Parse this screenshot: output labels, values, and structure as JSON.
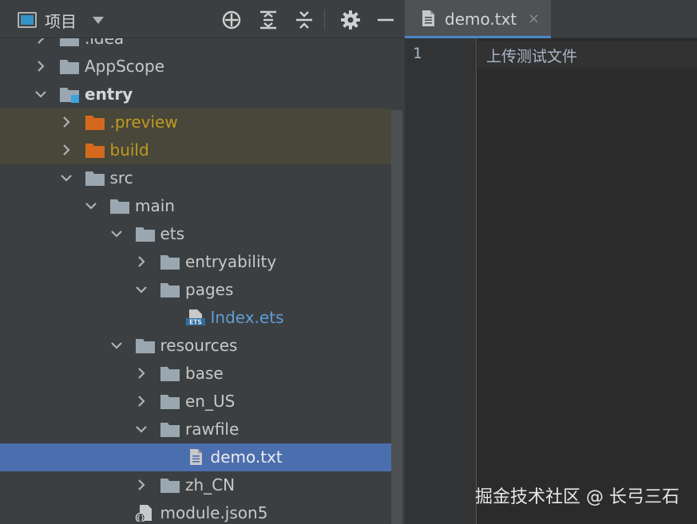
{
  "project_panel": {
    "title": "项目",
    "toolbar": [
      {
        "name": "locate-icon"
      },
      {
        "name": "expand-all-icon"
      },
      {
        "name": "collapse-all-icon"
      },
      {
        "name": "settings-gear-icon"
      },
      {
        "name": "hide-panel-icon"
      }
    ],
    "tree": [
      {
        "label": ".idea",
        "depth": 1,
        "type": "folder",
        "expanded": false,
        "style": "normal",
        "partial": true
      },
      {
        "label": "AppScope",
        "depth": 1,
        "type": "folder",
        "expanded": false,
        "style": "normal"
      },
      {
        "label": "entry",
        "depth": 1,
        "type": "module",
        "expanded": true,
        "style": "bold"
      },
      {
        "label": ".preview",
        "depth": 2,
        "type": "folder-excluded",
        "expanded": false,
        "style": "excluded"
      },
      {
        "label": "build",
        "depth": 2,
        "type": "folder-excluded",
        "expanded": false,
        "style": "excluded"
      },
      {
        "label": "src",
        "depth": 2,
        "type": "folder",
        "expanded": true,
        "style": "normal"
      },
      {
        "label": "main",
        "depth": 3,
        "type": "folder",
        "expanded": true,
        "style": "normal"
      },
      {
        "label": "ets",
        "depth": 4,
        "type": "folder",
        "expanded": true,
        "style": "normal"
      },
      {
        "label": "entryability",
        "depth": 5,
        "type": "folder",
        "expanded": false,
        "style": "normal"
      },
      {
        "label": "pages",
        "depth": 5,
        "type": "folder",
        "expanded": true,
        "style": "normal"
      },
      {
        "label": "Index.ets",
        "depth": 6,
        "type": "ets-file",
        "style": "ets"
      },
      {
        "label": "resources",
        "depth": 4,
        "type": "folder",
        "expanded": true,
        "style": "normal"
      },
      {
        "label": "base",
        "depth": 5,
        "type": "folder",
        "expanded": false,
        "style": "normal"
      },
      {
        "label": "en_US",
        "depth": 5,
        "type": "folder",
        "expanded": false,
        "style": "normal"
      },
      {
        "label": "rawfile",
        "depth": 5,
        "type": "folder",
        "expanded": true,
        "style": "normal"
      },
      {
        "label": "demo.txt",
        "depth": 6,
        "type": "text-file",
        "style": "selected"
      },
      {
        "label": "zh_CN",
        "depth": 5,
        "type": "folder",
        "expanded": false,
        "style": "normal"
      },
      {
        "label": "module.json5",
        "depth": 4,
        "type": "json-file",
        "style": "normal"
      }
    ]
  },
  "editor": {
    "tab": {
      "label": "demo.txt",
      "close": "×"
    },
    "lines": [
      {
        "number": "1",
        "text": "上传测试文件"
      }
    ]
  },
  "watermark": "掘金技术社区 @ 长弓三石",
  "colors": {
    "panel_bg": "#3c3f41",
    "editor_bg": "#2b2b2b",
    "selection": "#4b6eaf",
    "excluded_text": "#c09a1e",
    "excluded_folder": "#d4691e",
    "folder": "#9aa7b0",
    "ets_text": "#5f9ed8",
    "module_badge": "#3ea2db"
  }
}
